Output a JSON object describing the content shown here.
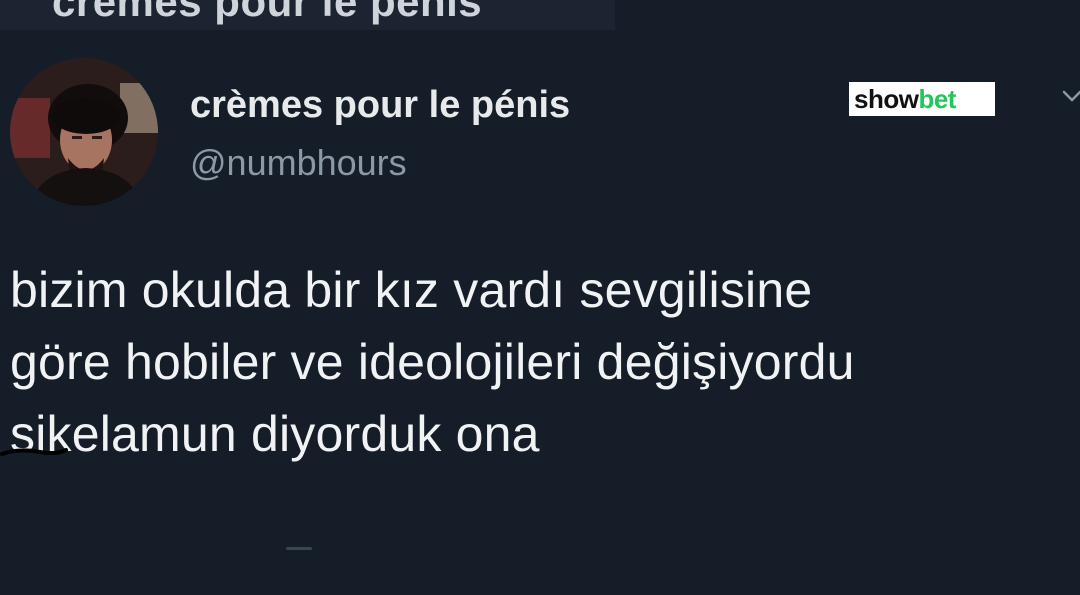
{
  "header_strip": {
    "text": "crèmes pour le pénis"
  },
  "tweet": {
    "display_name": "crèmes pour le pénis",
    "handle": "@numbhours",
    "text": "bizim okulda bir kız vardı sevgilisine\ngöre hobiler ve ideolojileri değişiyordu\nsikelamun diyorduk ona"
  },
  "watermark": {
    "logo_text": "showbet",
    "part1": "show",
    "part2": "bet",
    "colors": {
      "part1": "#111111",
      "part2": "#22c55e"
    }
  },
  "icons": {
    "more": "chevron-down-icon",
    "avatar": "avatar"
  },
  "colors": {
    "background": "#151d28",
    "name": "#e7e9ea",
    "handle": "#8b98a5",
    "text": "#f0f2f4"
  }
}
